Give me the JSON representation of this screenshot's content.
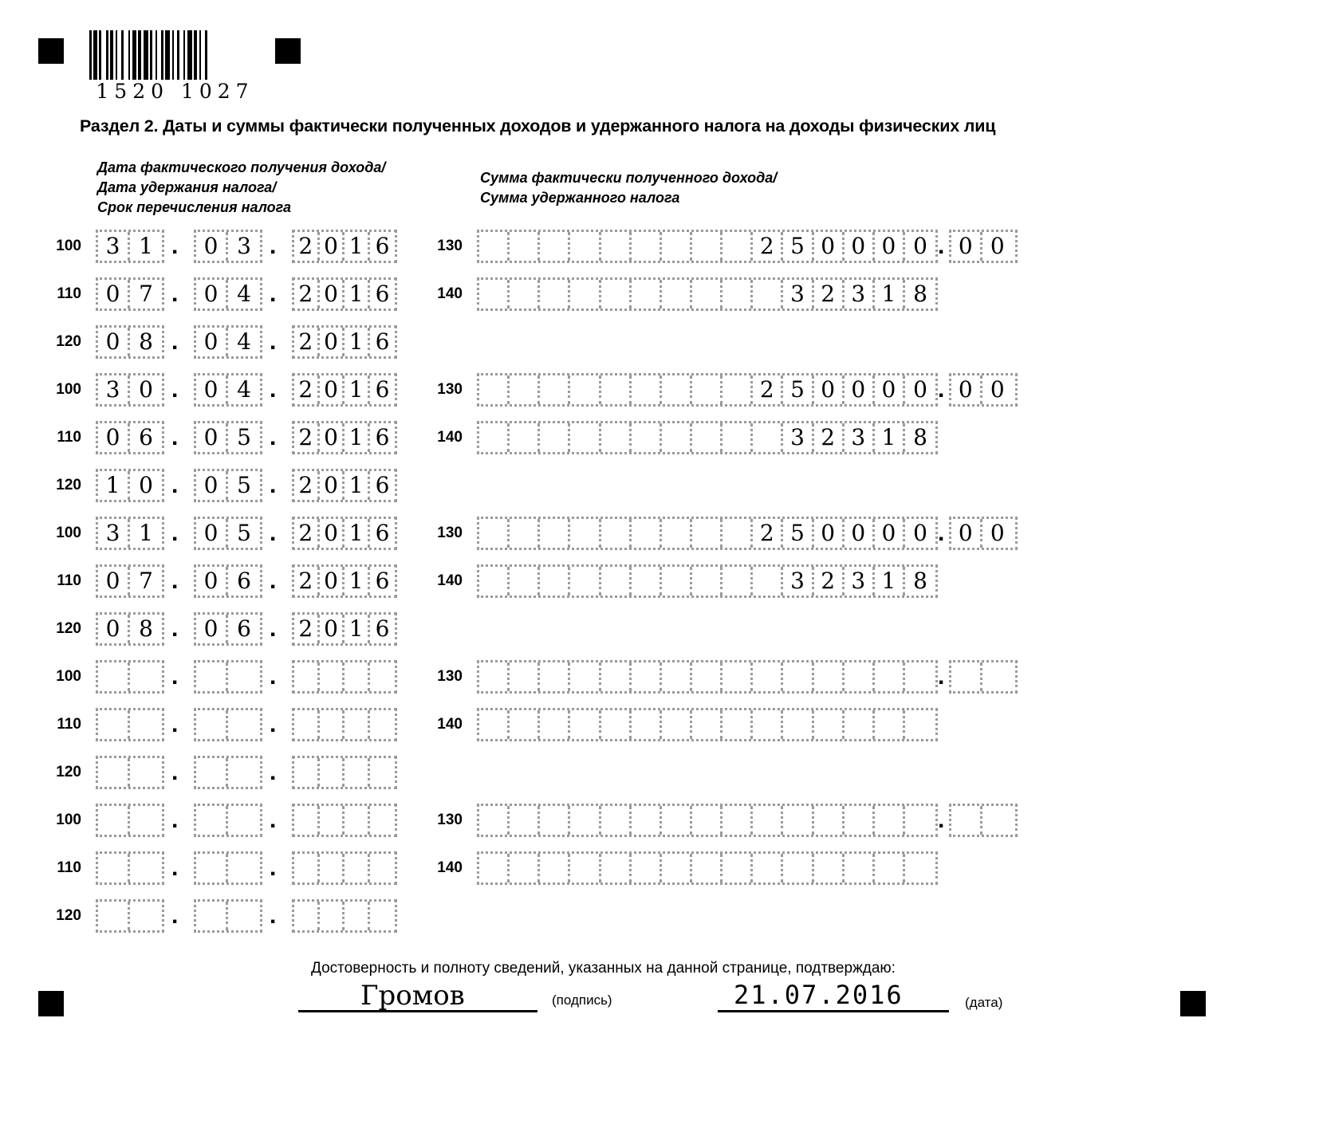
{
  "document": {
    "barcode_digits": "1520 1027",
    "title": "Раздел 2. Даты и суммы фактически полученных доходов и удержанного налога на доходы физических лиц",
    "caption_left": [
      "Дата фактического получения дохода/",
      "Дата удержания налога/",
      "Срок перечисления налога"
    ],
    "caption_right": [
      "Сумма фактически полученного дохода/",
      "Сумма удержанного налога"
    ]
  },
  "codes": {
    "date_income": "100",
    "date_withheld": "110",
    "date_transfer": "120",
    "amount_income": "130",
    "amount_tax": "140"
  },
  "blocks": [
    {
      "date_100": "31.03.2016",
      "date_110": "07.04.2016",
      "date_120": "08.04.2016",
      "amount_130_main": "250000",
      "amount_130_dec": "00",
      "amount_140_main": "32318",
      "amount_140_dec": ""
    },
    {
      "date_100": "30.04.2016",
      "date_110": "06.05.2016",
      "date_120": "10.05.2016",
      "amount_130_main": "250000",
      "amount_130_dec": "00",
      "amount_140_main": "32318",
      "amount_140_dec": ""
    },
    {
      "date_100": "31.05.2016",
      "date_110": "07.06.2016",
      "date_120": "08.06.2016",
      "amount_130_main": "250000",
      "amount_130_dec": "00",
      "amount_140_main": "32318",
      "amount_140_dec": ""
    },
    {
      "date_100": "",
      "date_110": "",
      "date_120": "",
      "amount_130_main": "",
      "amount_130_dec": "",
      "amount_140_main": "",
      "amount_140_dec": ""
    },
    {
      "date_100": "",
      "date_110": "",
      "date_120": "",
      "amount_130_main": "",
      "amount_130_dec": "",
      "amount_140_main": "",
      "amount_140_dec": ""
    }
  ],
  "footer": {
    "confirm_text": "Достоверность и полноту сведений, указанных на данной странице, подтверждаю:",
    "signature_value": "Громов",
    "signature_label": "(подпись)",
    "date_value": "21.07.2016",
    "date_label": "(дата)"
  },
  "layout": {
    "date_cells_main_count": 2,
    "date_cells_year_count": 4,
    "amount_main_cells": 15,
    "amount_dec_cells": 2,
    "tax_main_cells": 15,
    "block_tops": [
      288,
      348,
      408,
      468,
      528,
      588,
      648,
      708,
      768,
      828,
      888,
      948,
      1008,
      1068,
      1128
    ],
    "amount_tops": [
      288,
      348,
      468,
      528,
      648,
      708,
      828,
      888,
      1008,
      1068
    ]
  },
  "colors": {
    "cell_border": "#9a9a9a",
    "text": "#000000",
    "background": "#ffffff"
  }
}
